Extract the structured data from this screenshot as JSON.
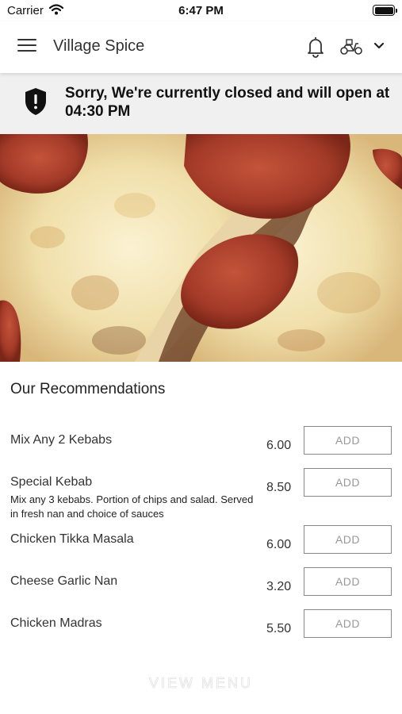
{
  "status_bar": {
    "carrier": "Carrier",
    "time": "6:47 PM"
  },
  "header": {
    "title": "Village Spice"
  },
  "banner": {
    "message": "Sorry, We're currently closed and will open at 04:30 PM"
  },
  "recommendations": {
    "title": "Our Recommendations",
    "add_label": "ADD",
    "items": [
      {
        "name": "Mix Any 2 Kebabs",
        "description": "",
        "price": "6.00"
      },
      {
        "name": "Special Kebab",
        "description": "Mix any 3 kebabs. Portion of chips and salad. Served in fresh nan and choice of sauces",
        "price": "8.50"
      },
      {
        "name": "Chicken Tikka Masala",
        "description": "",
        "price": "6.00"
      },
      {
        "name": "Cheese Garlic Nan",
        "description": "",
        "price": "3.20"
      },
      {
        "name": "Chicken Madras",
        "description": "",
        "price": "5.50"
      }
    ]
  },
  "footer": {
    "view_menu": "VIEW MENU"
  },
  "icons": [
    "menu-icon",
    "bell-icon",
    "delivery-scooter-icon",
    "chevron-down-icon",
    "shield-alert-icon",
    "wifi-icon",
    "battery-icon"
  ],
  "colors": {
    "banner_bg": "#f0f0f0",
    "text": "#222222",
    "button_border": "#888888",
    "button_text": "#999999"
  }
}
